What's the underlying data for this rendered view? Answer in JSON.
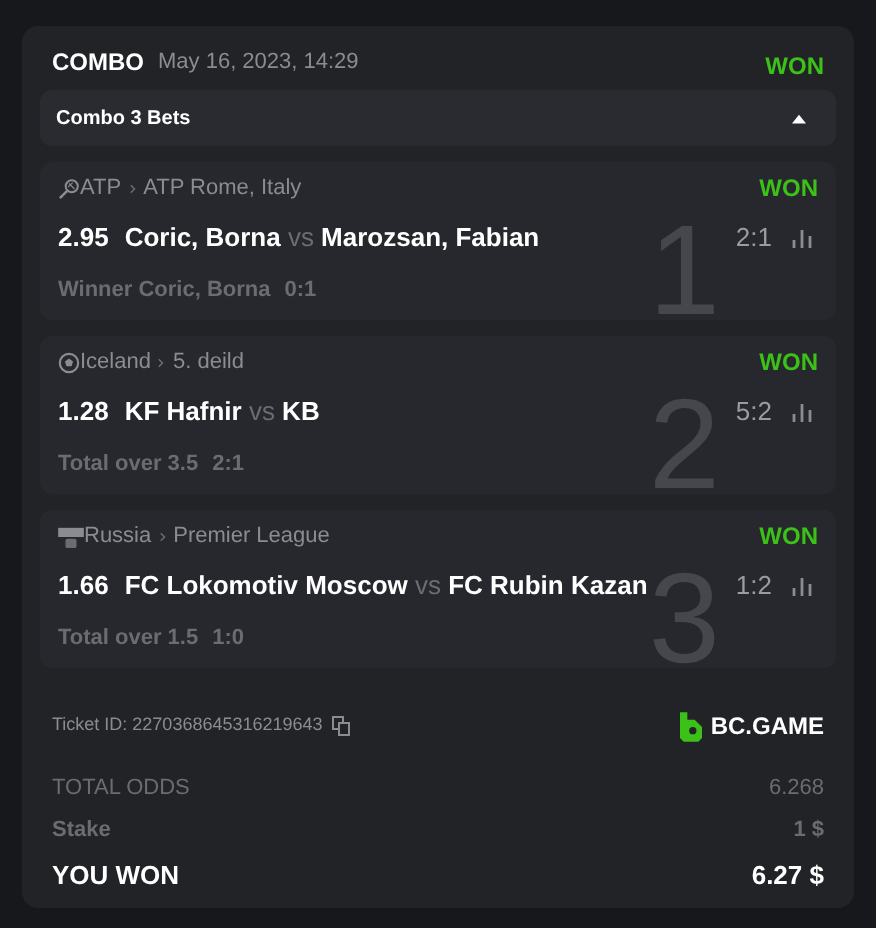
{
  "header": {
    "type": "COMBO",
    "date": "May 16, 2023, 14:29",
    "status": "WON"
  },
  "combo_bar": {
    "label": "Combo 3 Bets",
    "expanded": true
  },
  "bets": [
    {
      "kind": "tennis",
      "league": "ATP",
      "tournament": "ATP Rome, Italy",
      "status": "WON",
      "odds": "2.95",
      "home": "Coric, Borna",
      "vs": "vs",
      "away": "Marozsan, Fabian",
      "score": "2:1",
      "market": "Winner Coric, Borna",
      "market_score": "0:1",
      "number": "1"
    },
    {
      "kind": "soccer",
      "league": "Iceland",
      "tournament": "5. deild",
      "status": "WON",
      "odds": "1.28",
      "home": "KF Hafnir",
      "vs": "vs",
      "away": "KB",
      "score": "5:2",
      "market": "Total over 3.5",
      "market_score": "2:1",
      "number": "2"
    },
    {
      "kind": "fifa",
      "league": "Russia",
      "tournament": "Premier League",
      "status": "WON",
      "odds": "1.66",
      "home": "FC Lokomotiv Moscow",
      "vs": "vs",
      "away": "FC Rubin Kazan",
      "score": "1:2",
      "market": "Total over 1.5",
      "market_score": "1:0",
      "number": "3"
    }
  ],
  "ticket": {
    "label": "Ticket ID: 2270368645316219643",
    "brand": "BC.GAME"
  },
  "totals": [
    {
      "kind": "odds",
      "label": "TOTAL ODDS",
      "value": "6.268"
    },
    {
      "kind": "stake",
      "label": "Stake",
      "value": "1 $"
    },
    {
      "kind": "win",
      "label": "YOU WON",
      "value": "6.27 $"
    }
  ]
}
